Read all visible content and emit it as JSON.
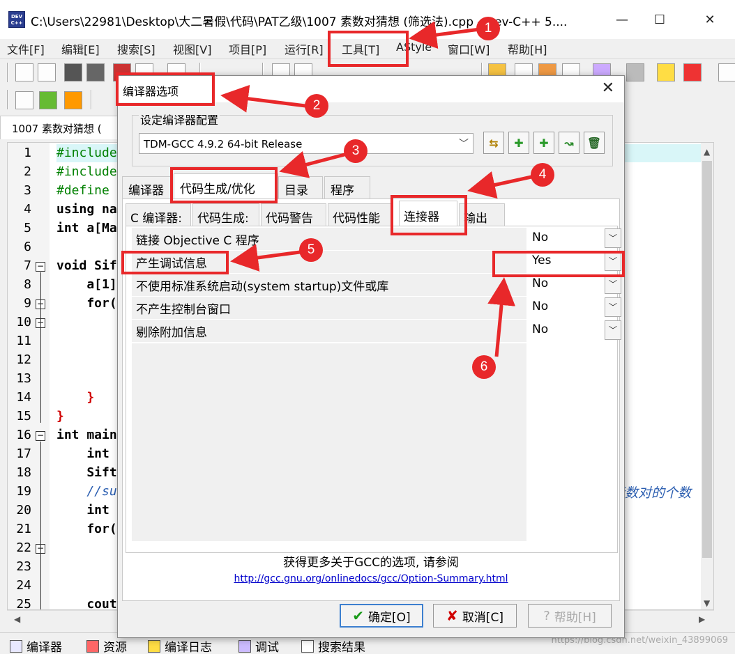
{
  "window": {
    "app_icon_text": "DEV C++",
    "title": "C:\\Users\\22981\\Desktop\\大二暑假\\代码\\PAT乙级\\1007 素数对猜想 (筛选法).cpp - Dev-C++ 5....",
    "minimize": "—",
    "maximize": "☐",
    "close": "✕"
  },
  "menu": [
    "文件[F]",
    "编辑[E]",
    "搜索[S]",
    "视图[V]",
    "项目[P]",
    "运行[R]",
    "工具[T]",
    "AStyle",
    "窗口[W]",
    "帮助[H]"
  ],
  "editor": {
    "file_tab": "1007 素数对猜想 (",
    "lines": [
      {
        "n": "1",
        "text": "#include"
      },
      {
        "n": "2",
        "text": "#include"
      },
      {
        "n": "3",
        "text": "#define"
      },
      {
        "n": "4",
        "text": "using na"
      },
      {
        "n": "5",
        "text": "int a[Ma"
      },
      {
        "n": "6",
        "text": ""
      },
      {
        "n": "7",
        "text": "void Sif"
      },
      {
        "n": "8",
        "text": "    a[1]"
      },
      {
        "n": "9",
        "text": "    for("
      },
      {
        "n": "10",
        "text": ""
      },
      {
        "n": "11",
        "text": ""
      },
      {
        "n": "12",
        "text": ""
      },
      {
        "n": "13",
        "text": ""
      },
      {
        "n": "14",
        "text": "    }"
      },
      {
        "n": "15",
        "text": "}"
      },
      {
        "n": "16",
        "text": "int main"
      },
      {
        "n": "17",
        "text": "    int"
      },
      {
        "n": "18",
        "text": "    Sift"
      },
      {
        "n": "19",
        "text": "    //su"
      },
      {
        "n": "20",
        "text": "    int"
      },
      {
        "n": "21",
        "text": "    for("
      },
      {
        "n": "22",
        "text": ""
      },
      {
        "n": "23",
        "text": ""
      },
      {
        "n": "24",
        "text": ""
      },
      {
        "n": "25",
        "text": "    cout"
      }
    ],
    "comment_tail": "素数对的个数"
  },
  "dialog": {
    "title": "编译器选项",
    "close": "✕",
    "config_group_label": "设定编译器配置",
    "compiler_combo_value": "TDM-GCC 4.9.2 64-bit Release",
    "tabs": [
      "编译器",
      "代码生成/优化",
      "目录",
      "程序"
    ],
    "subtabs": [
      "C 编译器:",
      "代码生成:",
      "代码警告",
      "代码性能",
      "连接器",
      "输出"
    ],
    "options": [
      {
        "label": "链接 Objective C 程序",
        "value": "No"
      },
      {
        "label": "产生调试信息",
        "value": "Yes"
      },
      {
        "label": "不使用标准系统启动(system startup)文件或库",
        "value": "No"
      },
      {
        "label": "不产生控制台窗口",
        "value": "No"
      },
      {
        "label": "剔除附加信息",
        "value": "No"
      }
    ],
    "more_info": "获得更多关于GCC的选项, 请参阅",
    "gcc_link": "http://gcc.gnu.org/onlinedocs/gcc/Option-Summary.html",
    "ok": "确定[O]",
    "cancel": "取消[C]",
    "help": "帮助[H]"
  },
  "bottom_tabs": [
    "编译器",
    "资源",
    "编译日志",
    "调试",
    "搜索结果"
  ],
  "watermark": "https://blog.csdn.net/weixin_43899069",
  "annotations": [
    "1",
    "2",
    "3",
    "4",
    "5",
    "6"
  ],
  "colors": {
    "annotation_red": "#e8282a",
    "preprocessor": "#008000",
    "comment": "#2a5db0",
    "link": "#0000cc"
  }
}
